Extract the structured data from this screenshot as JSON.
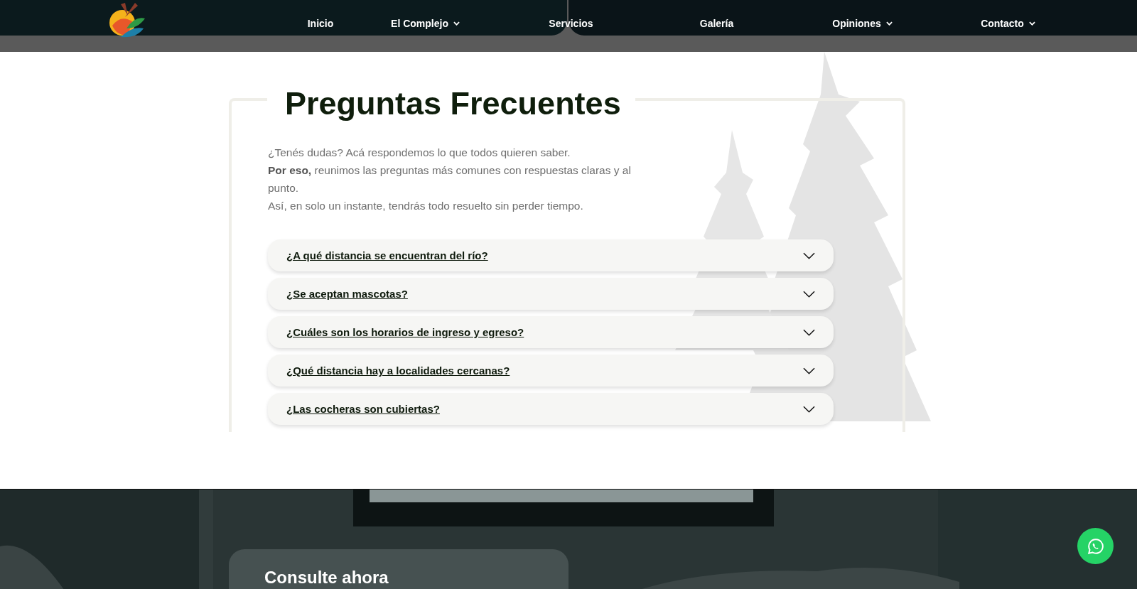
{
  "nav": {
    "items": [
      {
        "label": "Inicio",
        "kind": "link"
      },
      {
        "label": "El Complejo",
        "kind": "dropdown"
      },
      {
        "label": "Servicios",
        "kind": "link"
      },
      {
        "label": "Galería",
        "kind": "link"
      },
      {
        "label": "Opiniones",
        "kind": "dropdown"
      },
      {
        "label": "Contacto",
        "kind": "dropdown"
      }
    ]
  },
  "faq": {
    "title": "Preguntas Frecuentes",
    "intro": [
      "¿Tenés dudas? Acá respondemos lo que todos quieren saber.",
      "**Por eso,** reunimos las preguntas más comunes con respuestas claras y al punto.",
      "Así, en solo un instante, tendrás todo resuelto sin perder tiempo."
    ],
    "questions": [
      {
        "text": "¿A qué distancia se encuentran del río?",
        "expanded": false
      },
      {
        "text": "¿Se aceptan mascotas?",
        "expanded": false
      },
      {
        "text": "¿Cuáles son los horarios de ingreso y egreso?",
        "expanded": false
      },
      {
        "text": "¿Qué distancia hay a localidades cercanas?",
        "expanded": false
      },
      {
        "text": "¿Las cocheras son cubiertas?",
        "expanded": false
      }
    ]
  },
  "contact": {
    "title": "Consulte ahora"
  }
}
